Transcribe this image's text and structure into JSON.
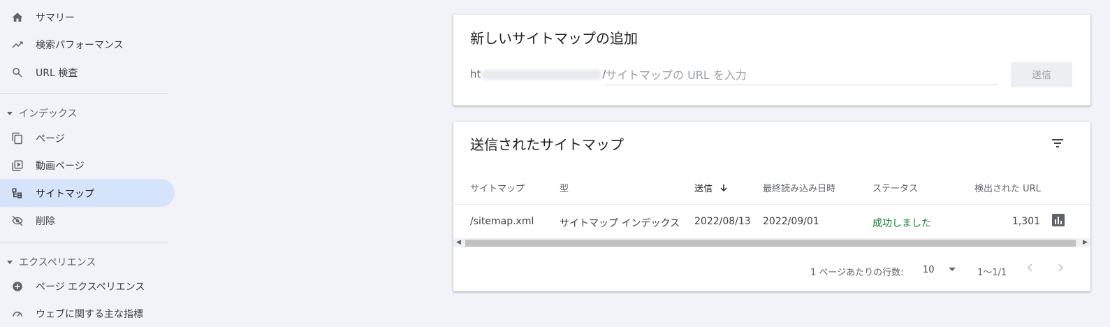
{
  "sidebar": {
    "items": [
      {
        "label": "サマリー",
        "icon": "home-icon"
      },
      {
        "label": "検索パフォーマンス",
        "icon": "trending-up-icon"
      },
      {
        "label": "URL 検査",
        "icon": "search-icon"
      }
    ],
    "index_section": {
      "label": "インデックス",
      "items": [
        {
          "label": "ページ",
          "icon": "pages-icon"
        },
        {
          "label": "動画ページ",
          "icon": "video-page-icon"
        },
        {
          "label": "サイトマップ",
          "icon": "sitemap-icon",
          "active": true
        },
        {
          "label": "削除",
          "icon": "visibility-off-icon"
        }
      ]
    },
    "experience_section": {
      "label": "エクスペリエンス",
      "items": [
        {
          "label": "ページ エクスペリエンス",
          "icon": "page-experience-icon"
        },
        {
          "label": "ウェブに関する主な指標",
          "icon": "speed-gauge-icon"
        }
      ]
    }
  },
  "add_sitemap": {
    "title": "新しいサイトマップの追加",
    "url_prefix_start": "ht",
    "url_prefix_end": "/",
    "input_placeholder": "サイトマップの URL を入力",
    "input_value": "",
    "submit_label": "送信"
  },
  "submitted": {
    "title": "送信されたサイトマップ",
    "columns": [
      "サイトマップ",
      "型",
      "送信",
      "最終読み込み日時",
      "ステータス",
      "検出された URL"
    ],
    "rows": [
      {
        "sitemap": "/sitemap.xml",
        "type": "サイトマップ インデックス",
        "submitted": "2022/08/13",
        "last_read": "2022/09/01",
        "status": "成功しました",
        "urls": "1,301"
      }
    ],
    "pagination": {
      "rows_per_page_label": "1 ページあたりの行数:",
      "rows_per_page": "10",
      "range": "1～1/1"
    }
  },
  "colors": {
    "accent_active": "#d6e4fb",
    "status_success": "#188038",
    "background": "#f1f3f9"
  }
}
